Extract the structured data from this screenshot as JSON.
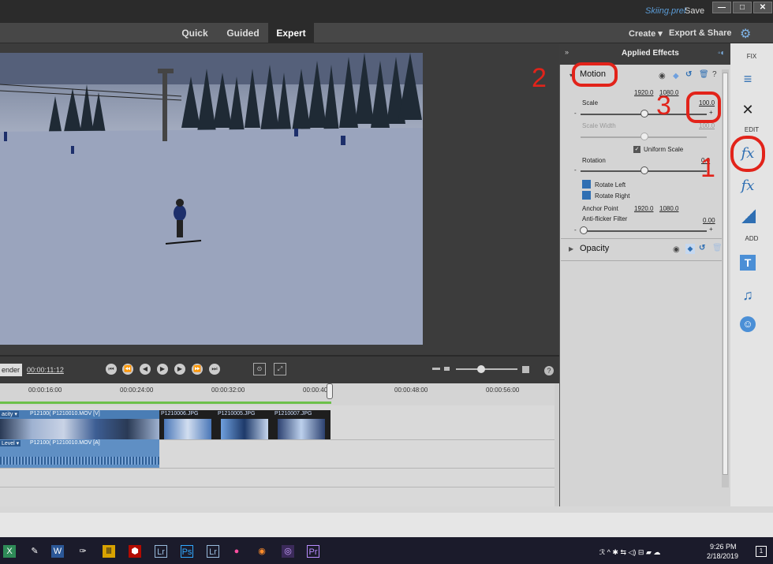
{
  "titlebar": {
    "file_name": "Skiing.prel",
    "save_label": "Save",
    "min_label": "—",
    "max_label": "□",
    "close_label": "✕"
  },
  "modes": {
    "quick": "Quick",
    "guided": "Guided",
    "expert": "Expert",
    "create": "Create ▾",
    "export": "Export & Share"
  },
  "timeline": {
    "render_label": "ender",
    "timecode": "00:00:11:12",
    "ruler": [
      "00:00:16:00",
      "00:00:24:00",
      "00:00:32:00",
      "00:00:40:0",
      "00:00:48:00",
      "00:00:56:00"
    ],
    "video_clip_tag": "acity ▾",
    "video_clip_label": "P12100( P1210010.MOV [V]",
    "photo_labels": [
      "P1210006.JPG",
      "P1210005.JPG",
      "P1210007.JPG"
    ],
    "audio_clip_tag": "Level ▾",
    "audio_clip_label": "P12100( P1210010.MOV [A]"
  },
  "effects": {
    "title": "Applied Effects",
    "motion_label": "Motion",
    "position_x": "1920.0",
    "position_y": "1080.0",
    "scale_label": "Scale",
    "scale_value": "100.0",
    "scale_width_label": "Scale Width",
    "scale_width_value": "100.0",
    "uniform_scale_label": "Uniform Scale",
    "rotation_label": "Rotation",
    "rotation_value": "0.0",
    "rotate_left": "Rotate Left",
    "rotate_right": "Rotate Right",
    "anchor_label": "Anchor Point",
    "anchor_x": "1920.0",
    "anchor_y": "1080.0",
    "flicker_label": "Anti-flicker Filter",
    "flicker_value": "0.00",
    "opacity_label": "Opacity",
    "minus": "-",
    "plus": "+"
  },
  "right_toolbar": {
    "fix_label": "FIX",
    "edit_label": "EDIT",
    "add_label": "ADD"
  },
  "annotations": [
    "1",
    "2",
    "3"
  ],
  "taskbar": {
    "time": "9:26 PM",
    "date": "2/18/2019",
    "tray": "ℛ ^ ✱ ⇆ ◁) ⊟ ▰ ☁"
  },
  "colors": {
    "accent_blue": "#2f6fb3",
    "annotation_red": "#e2231a",
    "timeline_green": "#6cc04a"
  }
}
